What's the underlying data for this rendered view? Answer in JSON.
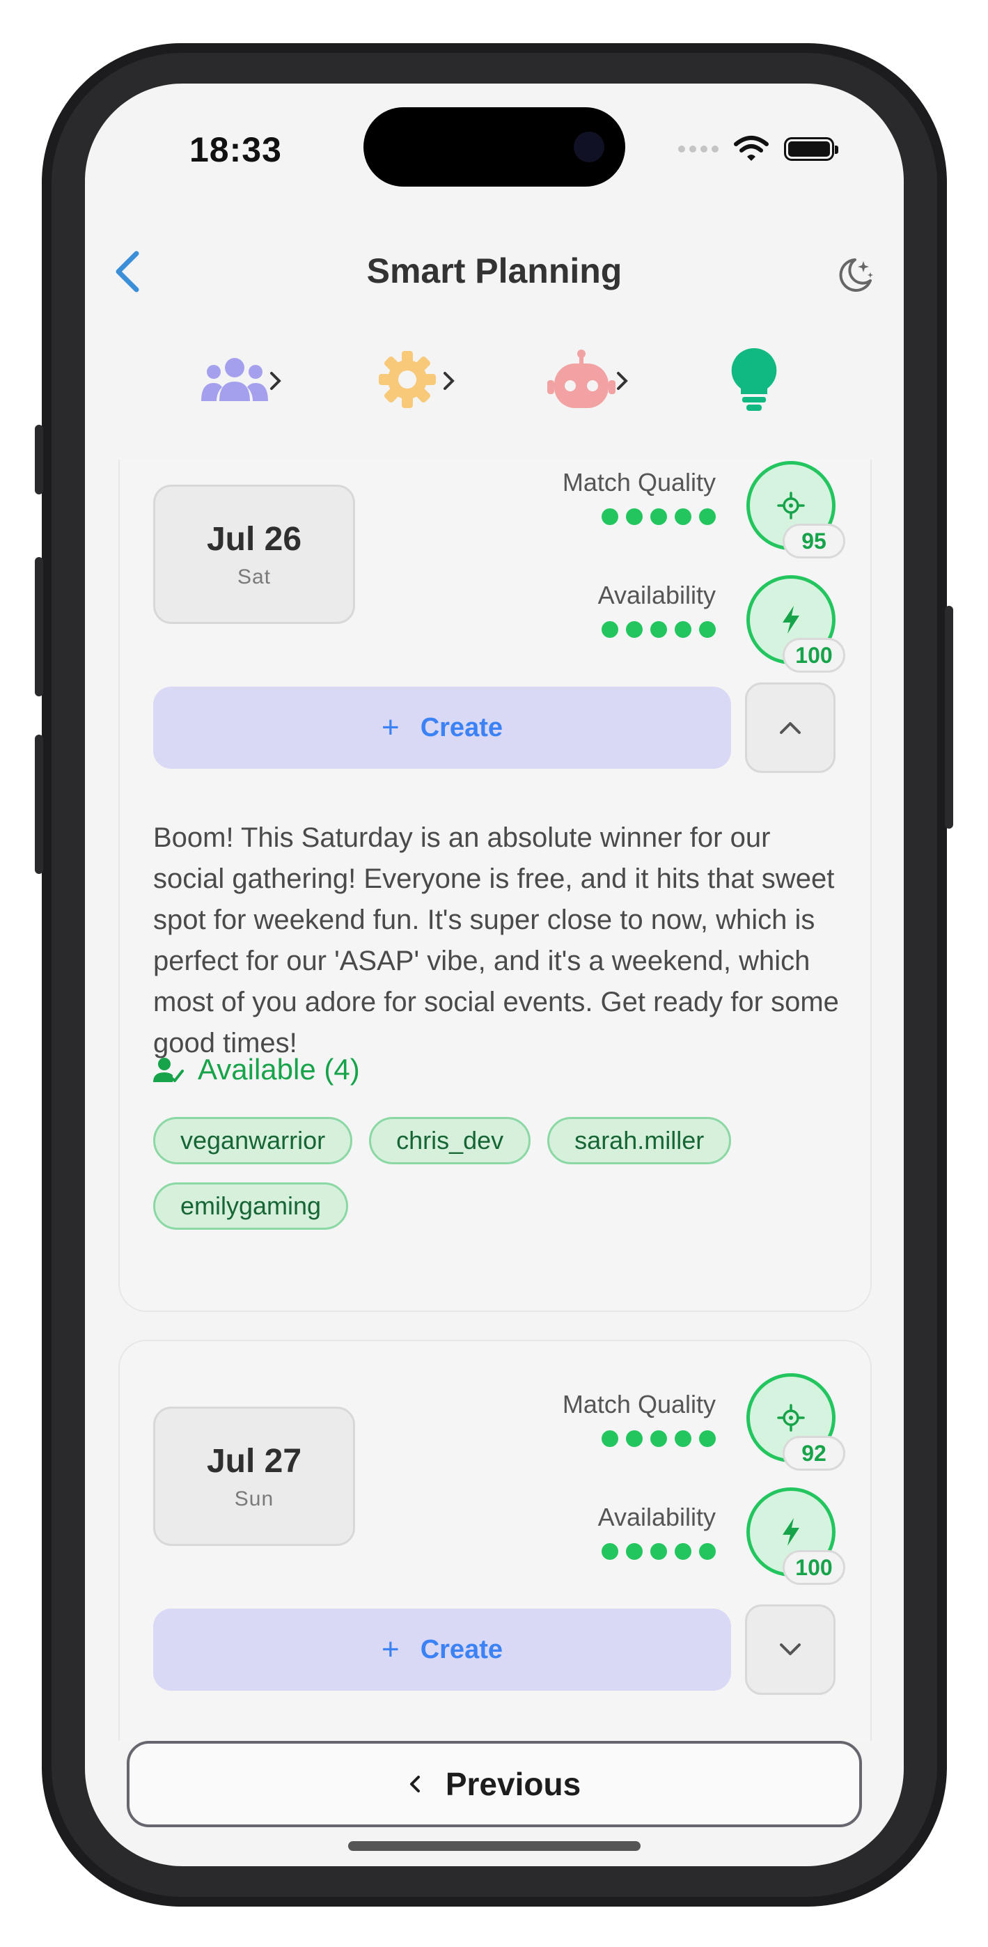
{
  "status": {
    "time": "18:33"
  },
  "header": {
    "title": "Smart Planning"
  },
  "stepper": {
    "steps": [
      "people-icon",
      "gear-icon",
      "robot-icon",
      "lightbulb-icon"
    ],
    "colors": [
      "#a5a0ee",
      "#f7c978",
      "#f2a2a2",
      "#22c55e"
    ]
  },
  "cards": [
    {
      "date": "Jul 26",
      "weekday": "Sat",
      "match_label": "Match Quality",
      "match_score": "95",
      "match_dots": 5,
      "availability_label": "Availability",
      "availability_score": "100",
      "availability_dots": 5,
      "create_label": "Create",
      "expanded": true,
      "description": "Boom! This Saturday is an absolute winner for our social gathering! Everyone is free, and it hits that sweet spot for weekend fun. It's super close to now, which is perfect for our 'ASAP' vibe, and it's a weekend, which most of you adore for social events. Get ready for some good times!",
      "available_label": "Available (4)",
      "available_users": [
        "veganwarrior",
        "chris_dev",
        "sarah.miller",
        "emilygaming"
      ]
    },
    {
      "date": "Jul 27",
      "weekday": "Sun",
      "match_label": "Match Quality",
      "match_score": "92",
      "match_dots": 5,
      "availability_label": "Availability",
      "availability_score": "100",
      "availability_dots": 5,
      "create_label": "Create",
      "expanded": false
    }
  ],
  "footer": {
    "previous_label": "Previous"
  },
  "colors": {
    "accent_green": "#22c55e",
    "accent_blue": "#3b82f6",
    "create_bg": "#d9d8f5"
  }
}
